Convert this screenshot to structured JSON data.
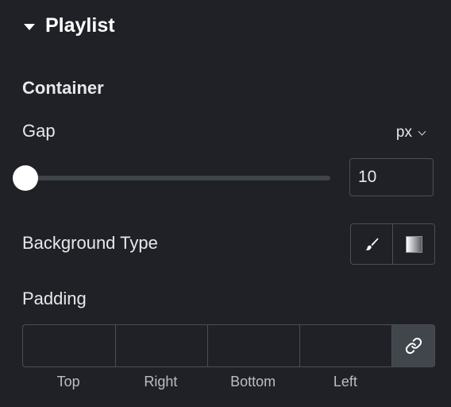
{
  "section": {
    "title": "Playlist",
    "icon": "caret-down-icon"
  },
  "container": {
    "heading": "Container"
  },
  "gap": {
    "label": "Gap",
    "unit": "px",
    "value": "10",
    "slider_fraction": 0.0
  },
  "background_type": {
    "label": "Background Type",
    "options": [
      {
        "icon": "brush-icon",
        "name": "Classic"
      },
      {
        "icon": "gradient-icon",
        "name": "Gradient"
      }
    ]
  },
  "padding": {
    "label": "Padding",
    "top": "",
    "right": "",
    "bottom": "",
    "left": "",
    "labels": {
      "top": "Top",
      "right": "Right",
      "bottom": "Bottom",
      "left": "Left"
    },
    "link_icon": "link-icon"
  }
}
